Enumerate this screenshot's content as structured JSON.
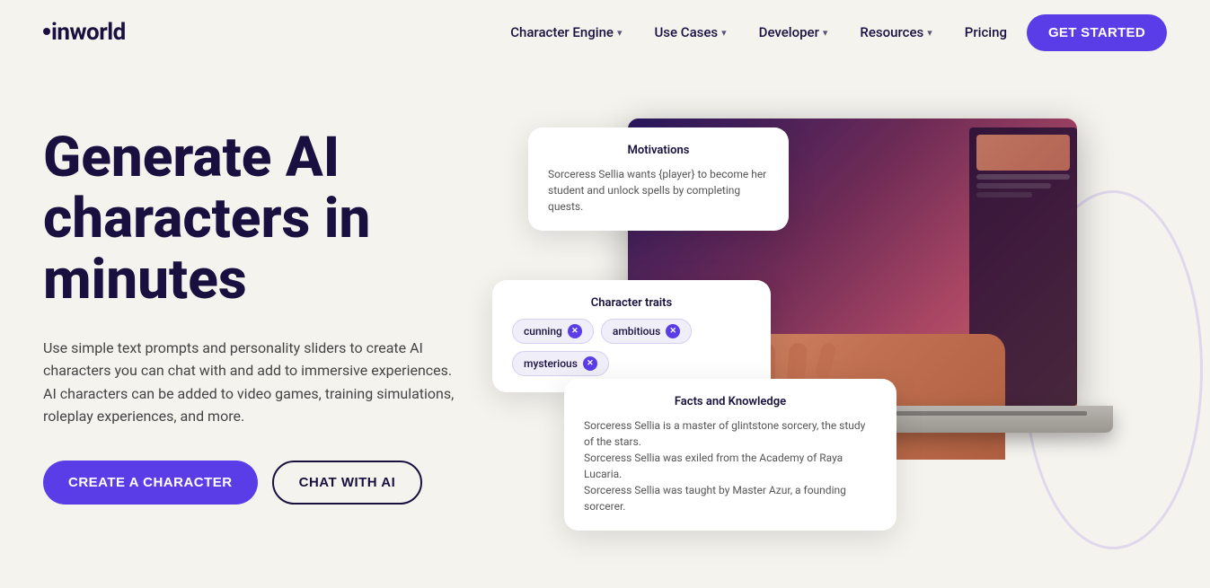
{
  "logo": {
    "text": "inworld"
  },
  "nav": {
    "items": [
      {
        "label": "Character Engine",
        "hasDropdown": true
      },
      {
        "label": "Use Cases",
        "hasDropdown": true
      },
      {
        "label": "Developer",
        "hasDropdown": true
      },
      {
        "label": "Resources",
        "hasDropdown": true
      },
      {
        "label": "Pricing",
        "hasDropdown": false
      }
    ],
    "cta_label": "GET STARTED"
  },
  "hero": {
    "title": "Generate AI characters in minutes",
    "description": "Use simple text prompts and personality sliders to create AI characters you can chat with and add to immersive experiences. AI characters can be added to video games, training simulations, roleplay experiences, and more.",
    "btn_primary": "CREATE A CHARACTER",
    "btn_secondary": "CHAT WITH AI"
  },
  "cards": {
    "motivations": {
      "title": "Motivations",
      "text": "Sorceress Sellia wants {player} to become her student and unlock spells by completing quests."
    },
    "traits": {
      "title": "Character traits",
      "pills": [
        {
          "label": "cunning"
        },
        {
          "label": "ambitious"
        },
        {
          "label": "mysterious"
        }
      ]
    },
    "facts": {
      "title": "Facts and Knowledge",
      "lines": [
        "Sorceress Sellia is a master of glintstone sorcery, the study of the stars.",
        "Sorceress Sellia was exiled from the Academy of Raya Lucaria.",
        "Sorceress Sellia was taught by Master Azur, a founding sorcerer."
      ]
    }
  }
}
